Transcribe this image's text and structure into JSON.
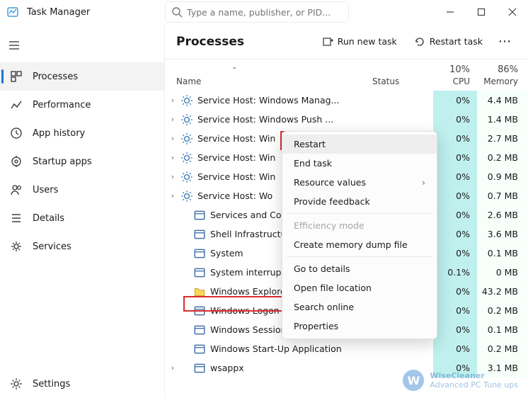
{
  "app": {
    "title": "Task Manager",
    "search_placeholder": "Type a name, publisher, or PID..."
  },
  "window_controls": [
    "minimize",
    "maximize",
    "close"
  ],
  "sidebar": {
    "items": [
      {
        "label": "Processes",
        "icon": "processes-icon",
        "active": true
      },
      {
        "label": "Performance",
        "icon": "performance-icon"
      },
      {
        "label": "App history",
        "icon": "history-icon"
      },
      {
        "label": "Startup apps",
        "icon": "startup-icon"
      },
      {
        "label": "Users",
        "icon": "users-icon"
      },
      {
        "label": "Details",
        "icon": "details-icon"
      },
      {
        "label": "Services",
        "icon": "services-icon"
      }
    ],
    "settings_label": "Settings"
  },
  "toolbar": {
    "page_title": "Processes",
    "run_new_task": "Run new task",
    "restart_task": "Restart task",
    "more": "…"
  },
  "columns": {
    "name": "Name",
    "status": "Status",
    "cpu": "CPU",
    "memory": "Memory",
    "cpu_usage": "10%",
    "memory_usage": "86%"
  },
  "rows": [
    {
      "expand": true,
      "icon": "gear",
      "name": "Service Host: Windows Manag...",
      "cpu": "0%",
      "mem": "4.4 MB"
    },
    {
      "expand": true,
      "icon": "gear",
      "name": "Service Host: Windows Push ...",
      "cpu": "0%",
      "mem": "1.4 MB"
    },
    {
      "expand": true,
      "icon": "gear",
      "name": "Service Host: Win",
      "cpu": "0%",
      "mem": "2.7 MB"
    },
    {
      "expand": true,
      "icon": "gear",
      "name": "Service Host: Win",
      "cpu": "0%",
      "mem": "0.2 MB"
    },
    {
      "expand": true,
      "icon": "gear",
      "name": "Service Host: Win",
      "cpu": "0%",
      "mem": "0.9 MB"
    },
    {
      "expand": true,
      "icon": "gear",
      "name": "Service Host: Wo",
      "cpu": "0%",
      "mem": "0.7 MB"
    },
    {
      "expand": false,
      "icon": "app",
      "name": "Services and Con",
      "cpu": "0%",
      "mem": "2.6 MB",
      "indent": true
    },
    {
      "expand": false,
      "icon": "app",
      "name": "Shell Infrastructu",
      "cpu": "0%",
      "mem": "3.6 MB",
      "indent": true
    },
    {
      "expand": false,
      "icon": "app",
      "name": "System",
      "cpu": "0%",
      "mem": "0.1 MB",
      "indent": true
    },
    {
      "expand": false,
      "icon": "app",
      "name": "System interrupt",
      "cpu": "0.1%",
      "mem": "0 MB",
      "indent": true,
      "status_hidden": true
    },
    {
      "expand": false,
      "icon": "folder",
      "name": "Windows Explorer",
      "cpu": "0%",
      "mem": "43.2 MB",
      "indent": true,
      "highlight": true
    },
    {
      "expand": false,
      "icon": "app",
      "name": "Windows Logon Application",
      "cpu": "0%",
      "mem": "0.2 MB",
      "indent": true
    },
    {
      "expand": false,
      "icon": "app",
      "name": "Windows Session Manager",
      "cpu": "0%",
      "mem": "0.1 MB",
      "indent": true
    },
    {
      "expand": false,
      "icon": "app",
      "name": "Windows Start-Up Application",
      "cpu": "0%",
      "mem": "0.2 MB",
      "indent": true
    },
    {
      "expand": true,
      "icon": "app",
      "name": "wsappx",
      "cpu": "0%",
      "mem": "3.1 MB",
      "indent": true
    }
  ],
  "context_menu": {
    "items": [
      {
        "label": "Restart",
        "hover": true
      },
      {
        "label": "End task"
      },
      {
        "label": "Resource values",
        "submenu": true
      },
      {
        "label": "Provide feedback"
      },
      {
        "sep": true
      },
      {
        "label": "Efficiency mode",
        "disabled": true
      },
      {
        "label": "Create memory dump file"
      },
      {
        "sep": true
      },
      {
        "label": "Go to details"
      },
      {
        "label": "Open file location"
      },
      {
        "label": "Search online"
      },
      {
        "label": "Properties"
      }
    ]
  },
  "watermark": {
    "brand": "WiseCleaner",
    "tagline": "Advanced PC Tune ups"
  }
}
